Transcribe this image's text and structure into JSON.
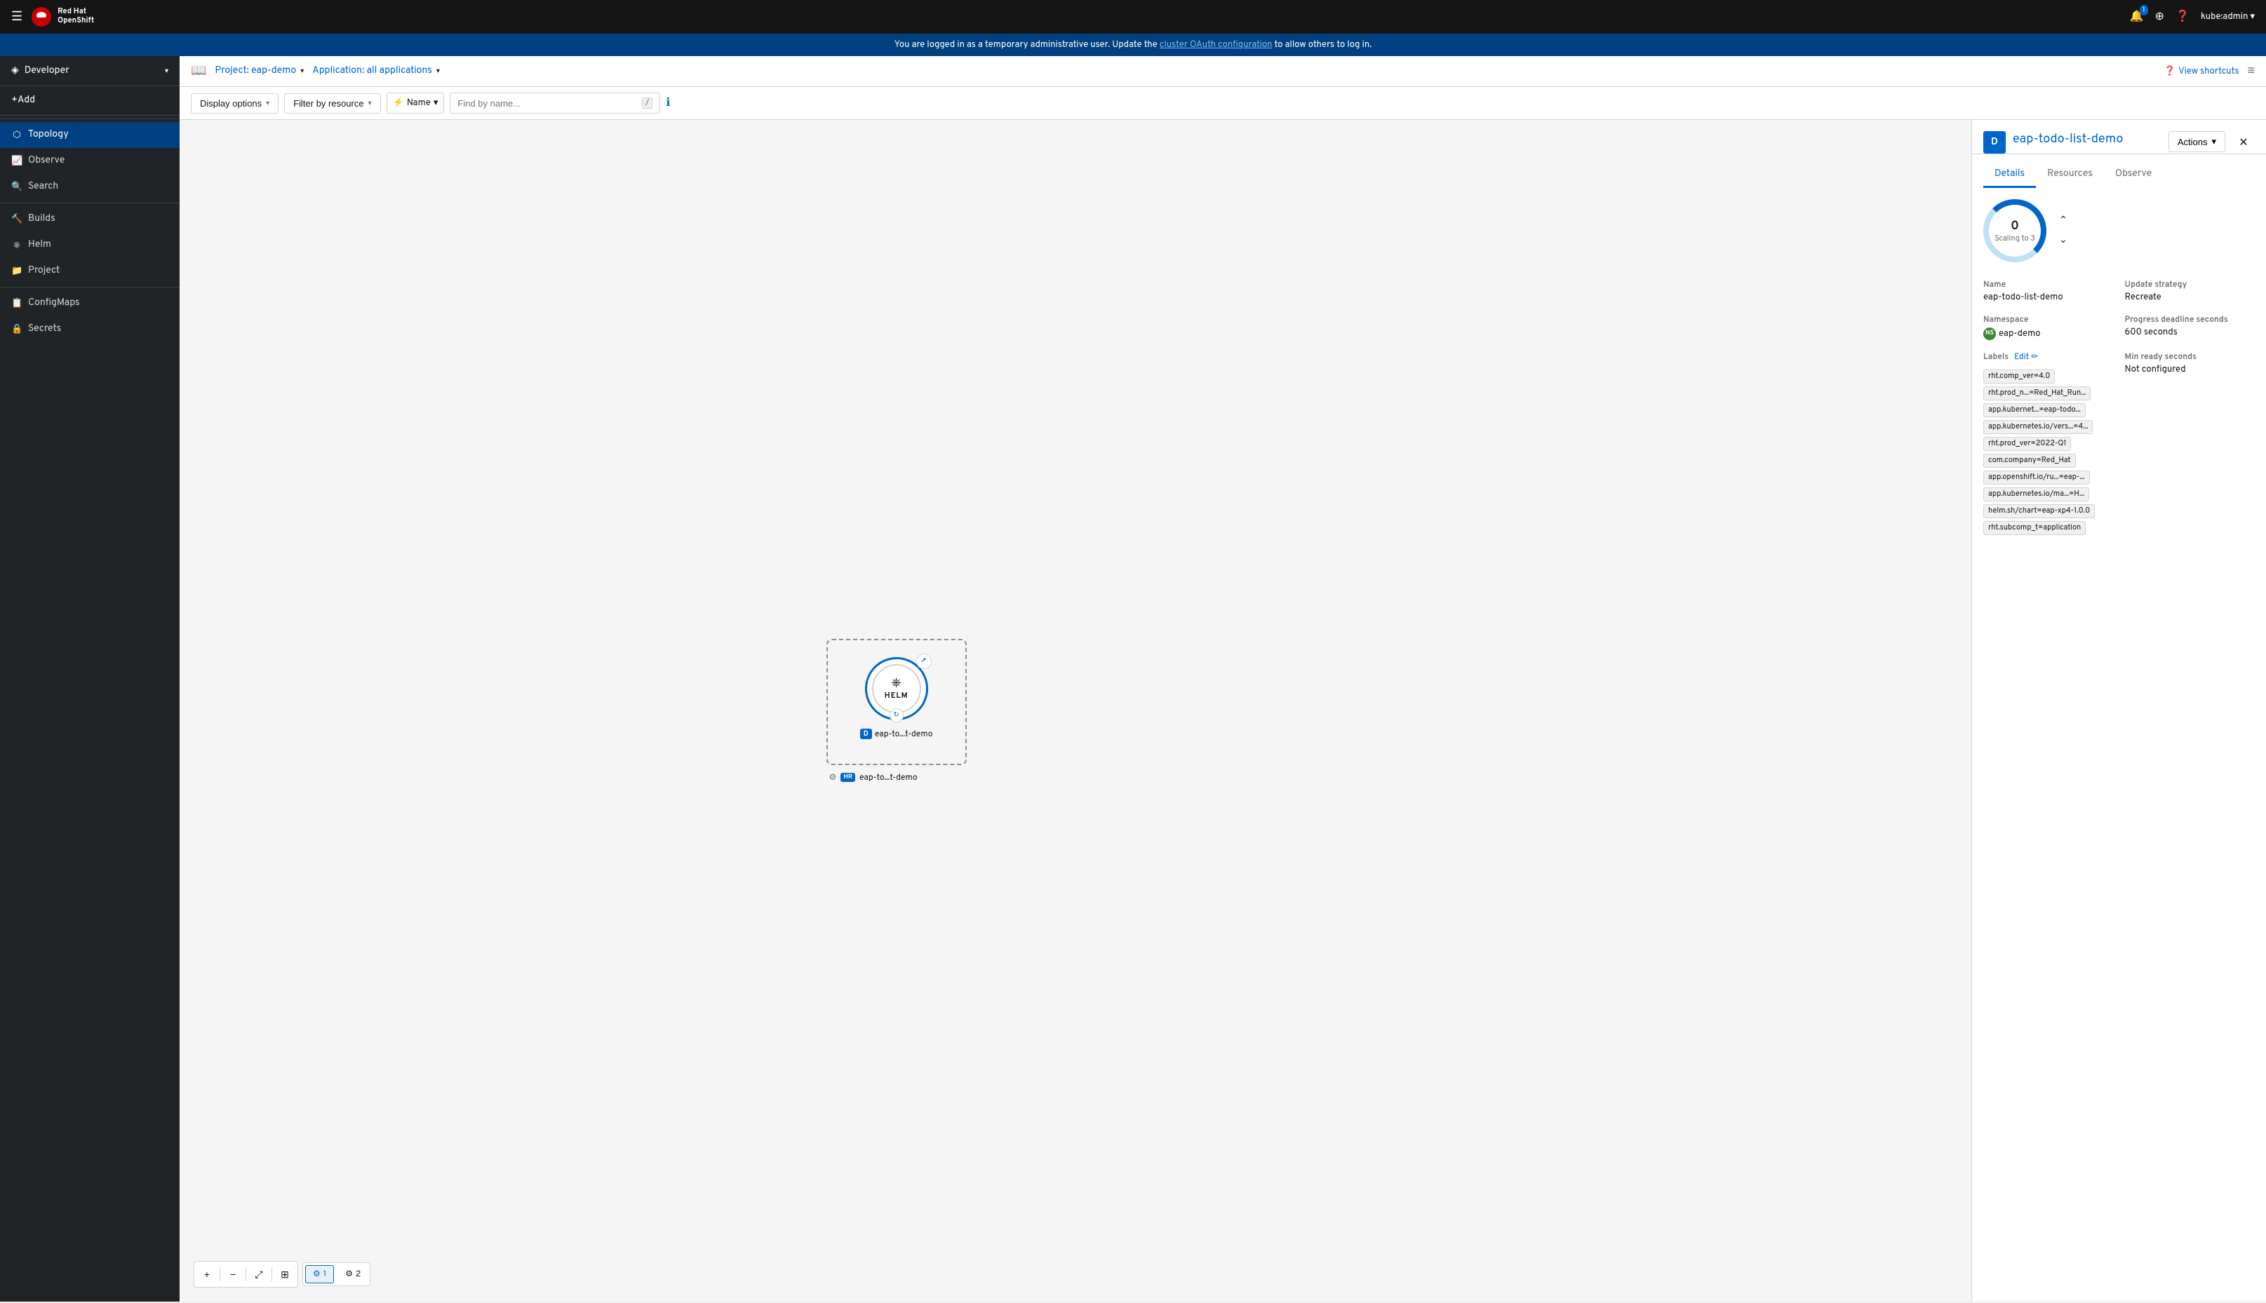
{
  "topnav": {
    "hamburger_icon": "☰",
    "brand_name": "Red Hat",
    "brand_sub": "OpenShift",
    "notifications_icon": "🔔",
    "notifications_count": "1",
    "add_icon": "+",
    "help_icon": "?",
    "user_label": "kube:admin",
    "user_chevron": "▾"
  },
  "banner": {
    "text": "You are logged in as a temporary administrative user. Update the",
    "link_text": "cluster OAuth configuration",
    "text_after": "to allow others to log in."
  },
  "sidebar": {
    "perspective_label": "Developer",
    "perspective_chevron": "▾",
    "add_label": "+Add",
    "items": [
      {
        "label": "Topology",
        "active": true,
        "icon": "⬡"
      },
      {
        "label": "Observe",
        "active": false,
        "icon": "📈"
      },
      {
        "label": "Search",
        "active": false,
        "icon": "🔍"
      },
      {
        "label": "Builds",
        "active": false,
        "icon": "🔨"
      },
      {
        "label": "Helm",
        "active": false,
        "icon": "⎈"
      },
      {
        "label": "Project",
        "active": false,
        "icon": "📁"
      },
      {
        "label": "ConfigMaps",
        "active": false,
        "icon": "📋"
      },
      {
        "label": "Secrets",
        "active": false,
        "icon": "🔒"
      }
    ]
  },
  "project_bar": {
    "project_label": "Project: eap-demo",
    "project_chevron": "▾",
    "app_label": "Application: all applications",
    "app_chevron": "▾",
    "view_shortcuts": "View shortcuts",
    "list_icon": "≡"
  },
  "filter_bar": {
    "display_options": "Display options",
    "filter_by_resource": "Filter by resource",
    "filter_name_label": "Name",
    "search_placeholder": "Find by name...",
    "keyboard_hint": "/",
    "filter_icon": "⚡"
  },
  "topology": {
    "node_id": "eap-to...t-demo",
    "node_full": "eap-todo-list-demo",
    "node_badge": "D",
    "helm_label": "HELM",
    "helm_release_badge": "HR",
    "helm_release_label": "eap-to...t-demo",
    "external_link_icon": "↗",
    "sync_icon": "↻",
    "gear_icon": "⚙"
  },
  "zoom_controls": {
    "zoom_in": "+",
    "zoom_out": "−",
    "fit_to_screen": "⊡",
    "reset_view": "⊞",
    "tab1_label": "1",
    "tab2_label": "2"
  },
  "right_panel": {
    "app_icon_letter": "D",
    "title": "eap-todo-list-demo",
    "actions_label": "Actions",
    "actions_chevron": "▾",
    "close_icon": "✕",
    "tabs": [
      {
        "label": "Details",
        "active": true
      },
      {
        "label": "Resources",
        "active": false
      },
      {
        "label": "Observe",
        "active": false
      }
    ],
    "scaling": {
      "count": "0",
      "label": "Scaling to 3",
      "up_arrow": "⌃",
      "down_arrow": "⌄"
    },
    "details": {
      "name_label": "Name",
      "name_value": "eap-todo-list-demo",
      "update_strategy_label": "Update strategy",
      "update_strategy_value": "Recreate",
      "namespace_label": "Namespace",
      "namespace_badge": "NS",
      "namespace_value": "eap-demo",
      "progress_deadline_label": "Progress deadline seconds",
      "progress_deadline_value": "600 seconds",
      "labels_label": "Labels",
      "edit_label": "Edit",
      "edit_icon": "✏",
      "min_ready_label": "Min ready seconds",
      "min_ready_value": "Not configured",
      "labels": [
        "rht.comp_ver=4.0",
        "rht.prod_n...=Red_Hat_Run...",
        "app.kubernet...=eap-todo...",
        "app.kubernetes.io/vers...=4...",
        "rht.prod_ver=2022-Q1",
        "com.company=Red_Hat",
        "app.openshift.io/ru...=eap-...",
        "app.kubernetes.io/ma...=H...",
        "helm.sh/chart=eap-xp4-1.0.0",
        "rht.subcomp_t=application"
      ]
    }
  }
}
